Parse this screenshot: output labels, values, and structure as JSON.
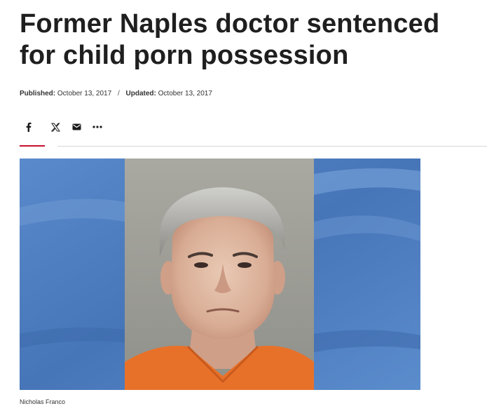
{
  "article": {
    "headline": "Former Naples doctor sentenced for child porn possession",
    "published_label": "Published:",
    "published_date": "October 13, 2017",
    "separator": "/",
    "updated_label": "Updated:",
    "updated_date": "October 13, 2017"
  },
  "share": {
    "buttons": [
      {
        "name": "facebook",
        "icon": "facebook-icon"
      },
      {
        "name": "x",
        "icon": "x-twitter-icon"
      },
      {
        "name": "email",
        "icon": "envelope-icon"
      },
      {
        "name": "more",
        "icon": "ellipsis-icon"
      }
    ]
  },
  "hero_image": {
    "caption": "Nicholas Franco"
  },
  "colors": {
    "accent": "#c8102e",
    "background_blue": "#4a7cc0",
    "jumpsuit_orange": "#e8712a"
  }
}
